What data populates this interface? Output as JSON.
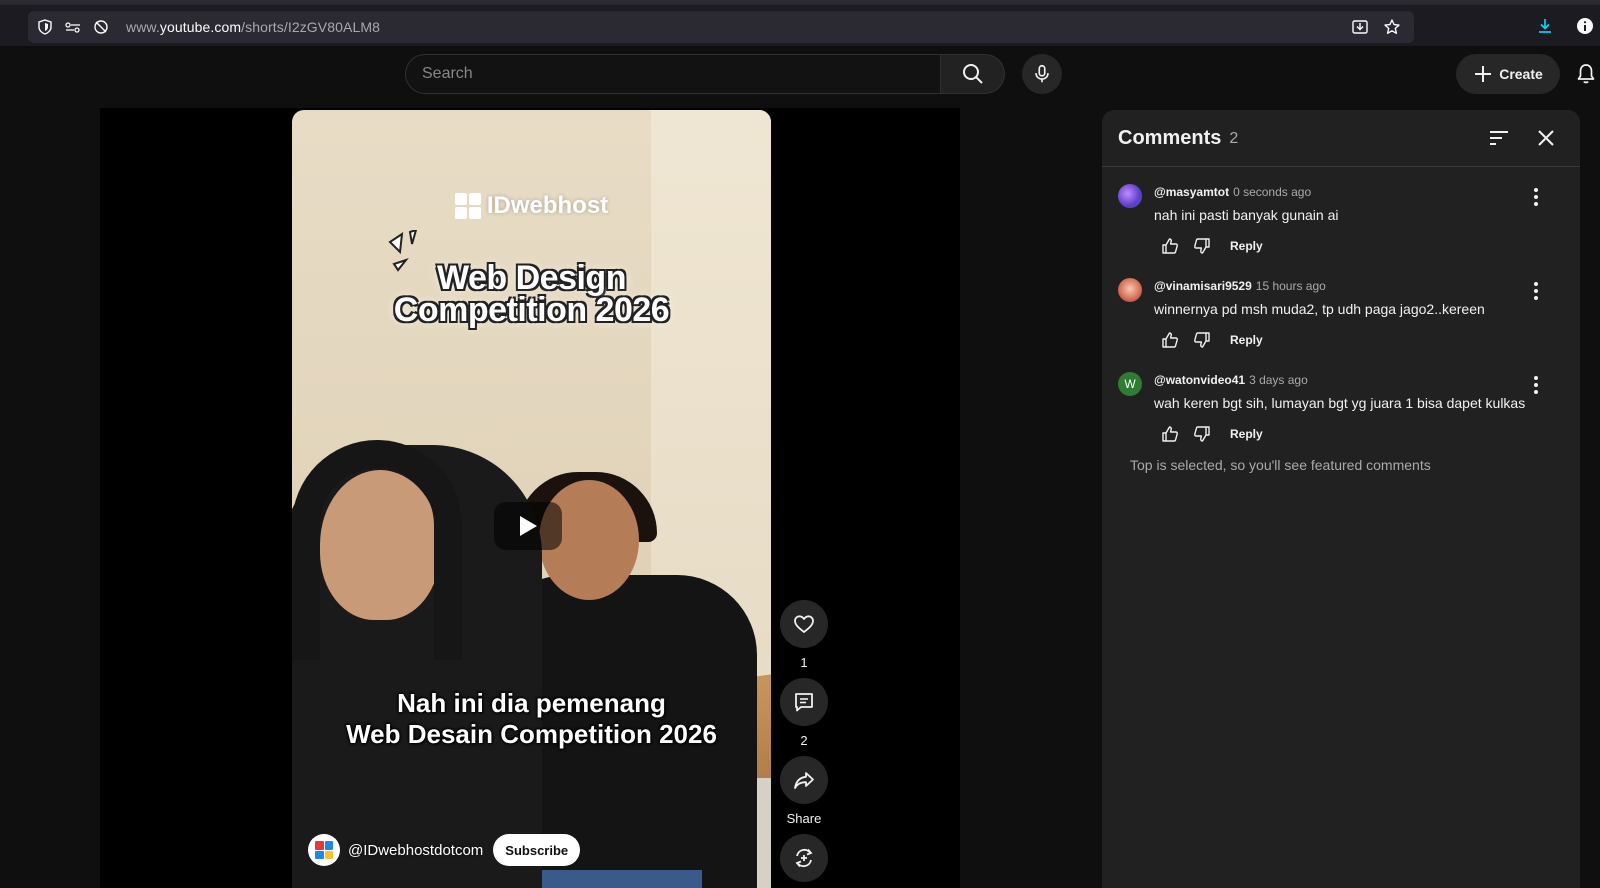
{
  "browser": {
    "url_prefix": "www.",
    "url_host": "youtube.com",
    "url_path": "/shorts/I2zGV80ALM8"
  },
  "header": {
    "search_placeholder": "Search",
    "create_label": "Create"
  },
  "video": {
    "brand": "IDwebhost",
    "title_line1": "Web Design",
    "title_line2": "Competition 2026",
    "caption_line1": "Nah ini dia pemenang",
    "caption_line2": "Web Desain Competition 2026",
    "channel_name": "@IDwebhostdotcom",
    "subscribe_label": "Subscribe"
  },
  "actions": {
    "likes": "1",
    "comments": "2",
    "share_label": "Share"
  },
  "comments_panel": {
    "title": "Comments",
    "count": "2",
    "items": [
      {
        "author": "@masyamtot",
        "time": "0 seconds ago",
        "text": "nah ini pasti banyak gunain ai",
        "reply": "Reply",
        "avatar_color": "#8e5bd6"
      },
      {
        "author": "@vinamisari9529",
        "time": "15 hours ago",
        "text": "winnernya pd msh muda2, tp udh paga jago2..kereen",
        "reply": "Reply",
        "avatar_color": "#d9735a"
      },
      {
        "author": "@watonvideo41",
        "time": "3 days ago",
        "text": "wah keren bgt sih, lumayan bgt yg juara 1 bisa dapet kulkas",
        "reply": "Reply",
        "avatar_color": "#2e7d32",
        "avatar_letter": "W"
      }
    ],
    "footnote": "Top is selected, so you'll see featured comments"
  },
  "colors": {
    "page_bg": "#0f0f0f",
    "panel_bg": "#212121",
    "accent_download": "#00ddff"
  }
}
